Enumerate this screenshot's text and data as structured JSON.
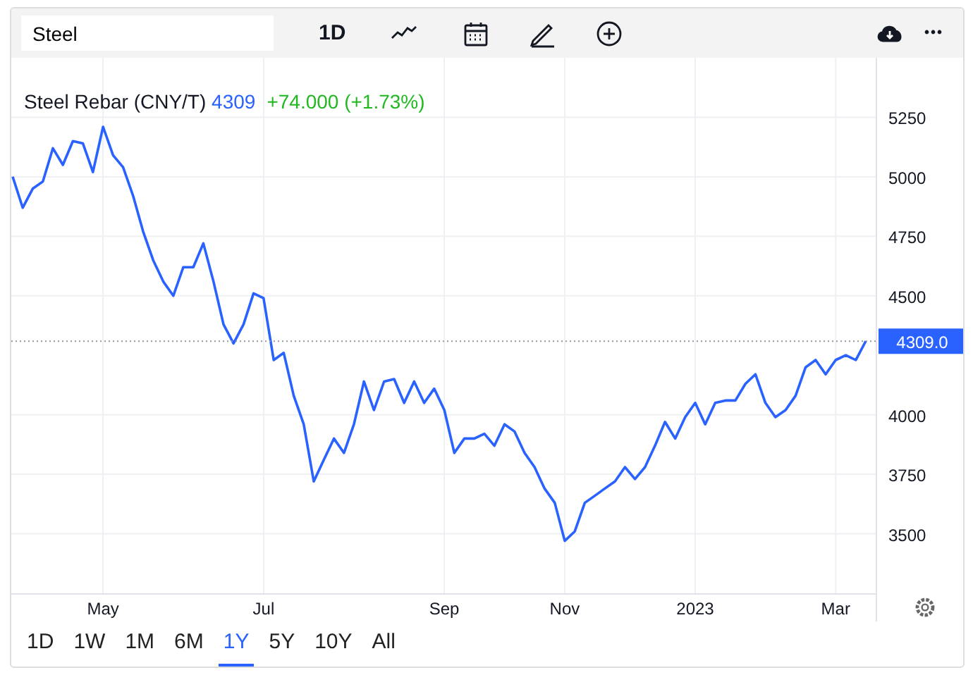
{
  "toolbar": {
    "search": {
      "value": "Steel"
    },
    "interval": "1D",
    "more": "•••"
  },
  "legend": {
    "price": "4309",
    "change": "+74.000 (+1.73%)"
  },
  "chart_data": {
    "type": "line",
    "categories": [
      null,
      null,
      null,
      null,
      null,
      null,
      null,
      null,
      null,
      "May",
      null,
      null,
      null,
      null,
      null,
      null,
      null,
      null,
      null,
      null,
      null,
      null,
      null,
      null,
      null,
      "Jul",
      null,
      null,
      null,
      null,
      null,
      null,
      null,
      null,
      null,
      null,
      null,
      null,
      null,
      null,
      null,
      null,
      null,
      "Sep",
      null,
      null,
      null,
      null,
      null,
      null,
      null,
      null,
      null,
      null,
      null,
      "Nov",
      null,
      null,
      null,
      null,
      null,
      null,
      null,
      null,
      null,
      null,
      null,
      null,
      "2023",
      null,
      null,
      null,
      null,
      null,
      null,
      null,
      null,
      null,
      null,
      null,
      null,
      null,
      "Mar",
      null,
      null,
      null
    ],
    "series": [
      {
        "name": "Steel Rebar (CNY/T)",
        "color": "#2962ff",
        "values": [
          5000,
          4870,
          4950,
          4980,
          5120,
          5050,
          5150,
          5140,
          5020,
          5210,
          5090,
          5040,
          4920,
          4770,
          4650,
          4560,
          4500,
          4620,
          4620,
          4720,
          4560,
          4380,
          4300,
          4380,
          4510,
          4490,
          4230,
          4260,
          4080,
          3960,
          3720,
          3810,
          3900,
          3840,
          3960,
          4140,
          4020,
          4140,
          4150,
          4050,
          4140,
          4050,
          4110,
          4020,
          3840,
          3900,
          3900,
          3920,
          3870,
          3960,
          3930,
          3840,
          3780,
          3690,
          3630,
          3470,
          3510,
          3630,
          3660,
          3690,
          3720,
          3780,
          3730,
          3780,
          3870,
          3970,
          3900,
          3990,
          4050,
          3960,
          4050,
          4060,
          4060,
          4130,
          4170,
          4050,
          3990,
          4020,
          4080,
          4200,
          4230,
          4170,
          4230,
          4250,
          4230,
          4310
        ]
      }
    ],
    "ylim": [
      3250,
      5500
    ],
    "grid": true,
    "ref_lines": [
      {
        "axis": "y",
        "value": 4309,
        "label": "4309.0"
      }
    ],
    "yticks": [
      3500,
      3750,
      4000,
      4500,
      4750,
      5000,
      5250
    ]
  },
  "ranges": [
    {
      "label": "1D",
      "selected": false
    },
    {
      "label": "1W",
      "selected": false
    },
    {
      "label": "1M",
      "selected": false
    },
    {
      "label": "6M",
      "selected": false
    },
    {
      "label": "1Y",
      "selected": true
    },
    {
      "label": "5Y",
      "selected": false
    },
    {
      "label": "10Y",
      "selected": false
    },
    {
      "label": "All",
      "selected": false
    }
  ]
}
